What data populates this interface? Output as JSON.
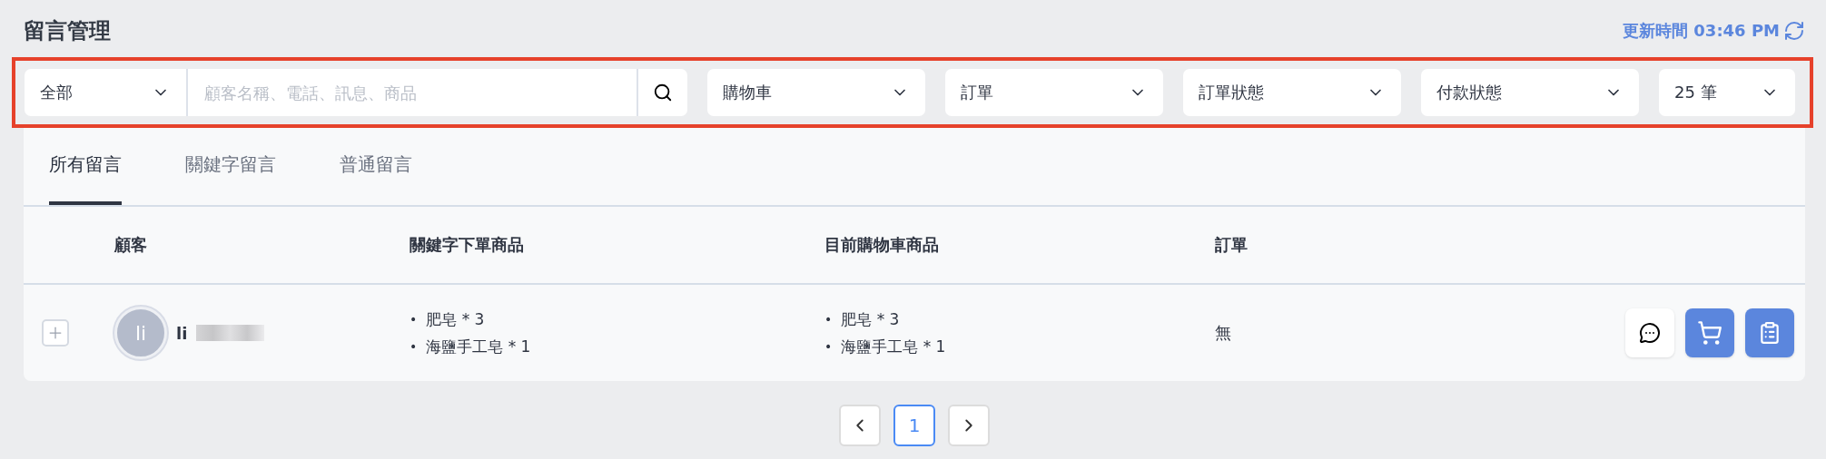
{
  "page_title": "留言管理",
  "updated": {
    "label": "更新時間 03:46 PM"
  },
  "filters": {
    "scope": {
      "value": "全部"
    },
    "search": {
      "placeholder": "顧客名稱、電話、訊息、商品"
    },
    "dropdowns": [
      {
        "value": "購物車"
      },
      {
        "value": "訂單"
      },
      {
        "value": "訂單狀態"
      },
      {
        "value": "付款狀態"
      },
      {
        "value": "25 筆",
        "kind": "small"
      }
    ]
  },
  "tabs": [
    {
      "label": "所有留言",
      "selected": true
    },
    {
      "label": "關鍵字留言",
      "selected": false
    },
    {
      "label": "普通留言",
      "selected": false
    }
  ],
  "table": {
    "columns": [
      "顧客",
      "關鍵字下單商品",
      "目前購物車商品",
      "訂單"
    ],
    "rows": [
      {
        "expanded": false,
        "bullet": "•",
        "avatar": "li",
        "name": "li",
        "keyword_items": [
          "肥皂 * 3",
          "海鹽手工皂 * 1"
        ],
        "cart_items": [
          "肥皂 * 3",
          "海鹽手工皂 * 1"
        ],
        "order": "無"
      }
    ]
  },
  "pagination": {
    "pages": [
      {
        "label": "1",
        "selected": true
      }
    ]
  }
}
